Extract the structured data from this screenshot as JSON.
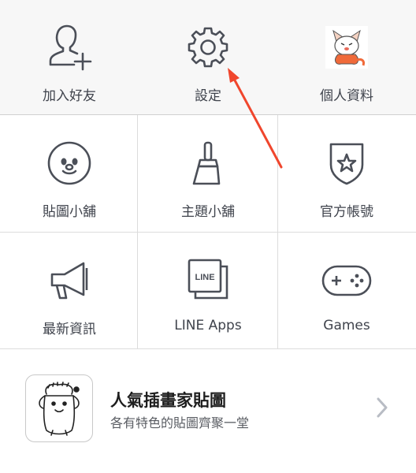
{
  "top_row": [
    {
      "label": "加入好友",
      "icon": "add-friend-icon"
    },
    {
      "label": "設定",
      "icon": "gear-icon"
    },
    {
      "label": "個人資料",
      "icon": "profile-avatar"
    }
  ],
  "grid": [
    {
      "label": "貼圖小舖",
      "icon": "sticker-face-icon"
    },
    {
      "label": "主題小舖",
      "icon": "paint-brush-icon"
    },
    {
      "label": "官方帳號",
      "icon": "shield-star-icon"
    },
    {
      "label": "最新資訊",
      "icon": "megaphone-icon"
    },
    {
      "label": "LINE Apps",
      "icon": "line-apps-icon",
      "icon_text": "LINE"
    },
    {
      "label": "Games",
      "icon": "gamepad-icon"
    }
  ],
  "banner": {
    "title": "人氣插畫家貼圖",
    "subtitle": "各有特色的貼圖齊聚一堂",
    "thumb_icon": "sticker-character-thumbnail",
    "chevron_icon": "chevron-right-icon"
  },
  "annotation": {
    "type": "red-arrow",
    "points_to": "設定",
    "color": "#f0462d"
  },
  "colors": {
    "icon": "#4b4f58",
    "top_bg": "#f7f7f7",
    "divider": "#dcdcdc",
    "chevron": "#b8bcc4"
  }
}
